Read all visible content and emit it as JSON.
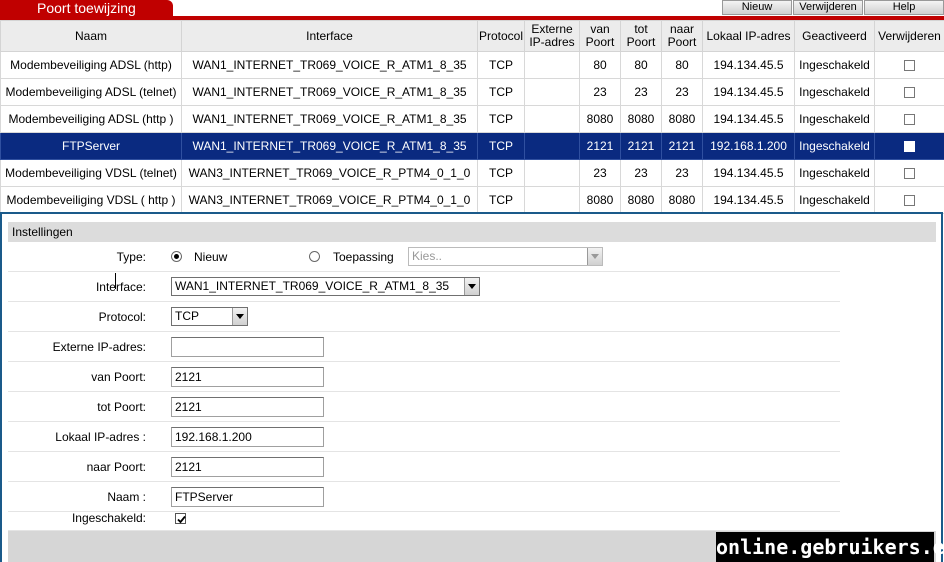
{
  "header": {
    "title": "Poort toewijzing",
    "buttons": {
      "new": "Nieuw",
      "delete": "Verwijderen",
      "help": "Help"
    }
  },
  "table": {
    "headers": [
      "Naam",
      "Interface",
      "Protocol",
      "Externe IP-adres",
      "van Poort",
      "tot Poort",
      "naar Poort",
      "Lokaal IP-adres",
      "Geactiveerd",
      "Verwijderen"
    ],
    "rows": [
      {
        "name": "Modembeveiliging ADSL (http)",
        "interface": "WAN1_INTERNET_TR069_VOICE_R_ATM1_8_35",
        "protocol": "TCP",
        "ext_ip": "",
        "from_port": "80",
        "to_port": "80",
        "dest_port": "80",
        "local_ip": "194.134.45.5",
        "status": "Ingeschakeld",
        "selected": false
      },
      {
        "name": "Modembeveiliging ADSL (telnet)",
        "interface": "WAN1_INTERNET_TR069_VOICE_R_ATM1_8_35",
        "protocol": "TCP",
        "ext_ip": "",
        "from_port": "23",
        "to_port": "23",
        "dest_port": "23",
        "local_ip": "194.134.45.5",
        "status": "Ingeschakeld",
        "selected": false
      },
      {
        "name": "Modembeveiliging ADSL (http )",
        "interface": "WAN1_INTERNET_TR069_VOICE_R_ATM1_8_35",
        "protocol": "TCP",
        "ext_ip": "",
        "from_port": "8080",
        "to_port": "8080",
        "dest_port": "8080",
        "local_ip": "194.134.45.5",
        "status": "Ingeschakeld",
        "selected": false
      },
      {
        "name": "FTPServer",
        "interface": "WAN1_INTERNET_TR069_VOICE_R_ATM1_8_35",
        "protocol": "TCP",
        "ext_ip": "",
        "from_port": "2121",
        "to_port": "2121",
        "dest_port": "2121",
        "local_ip": "192.168.1.200",
        "status": "Ingeschakeld",
        "selected": true
      },
      {
        "name": "Modembeveiliging VDSL (telnet)",
        "interface": "WAN3_INTERNET_TR069_VOICE_R_PTM4_0_1_0",
        "protocol": "TCP",
        "ext_ip": "",
        "from_port": "23",
        "to_port": "23",
        "dest_port": "23",
        "local_ip": "194.134.45.5",
        "status": "Ingeschakeld",
        "selected": false
      },
      {
        "name": "Modembeveiliging VDSL ( http )",
        "interface": "WAN3_INTERNET_TR069_VOICE_R_PTM4_0_1_0",
        "protocol": "TCP",
        "ext_ip": "",
        "from_port": "8080",
        "to_port": "8080",
        "dest_port": "8080",
        "local_ip": "194.134.45.5",
        "status": "Ingeschakeld",
        "selected": false
      }
    ]
  },
  "settings": {
    "title": "Instellingen",
    "type_label": "Type:",
    "type_new": "Nieuw",
    "type_app": "Toepassing",
    "app_select": "Kies..",
    "interface_label": "Interface:",
    "interface_value": "WAN1_INTERNET_TR069_VOICE_R_ATM1_8_35",
    "protocol_label": "Protocol:",
    "protocol_value": "TCP",
    "ext_ip_label": "Externe IP-adres:",
    "ext_ip_value": "",
    "from_port_label": "van Poort:",
    "from_port_value": "2121",
    "to_port_label": "tot Poort:",
    "to_port_value": "2121",
    "local_ip_label": "Lokaal IP-adres :",
    "local_ip_value": "192.168.1.200",
    "dest_port_label": "naar Poort:",
    "dest_port_value": "2121",
    "name_label": "Naam :",
    "name_value": "FTPServer",
    "enabled_label": "Ingeschakeld:",
    "enabled": true
  },
  "watermark": "online.gebruikers.eu",
  "colors": {
    "accent": "#c00000",
    "selected_row": "#0a2a80",
    "panel_border": "#1a5a8a"
  }
}
